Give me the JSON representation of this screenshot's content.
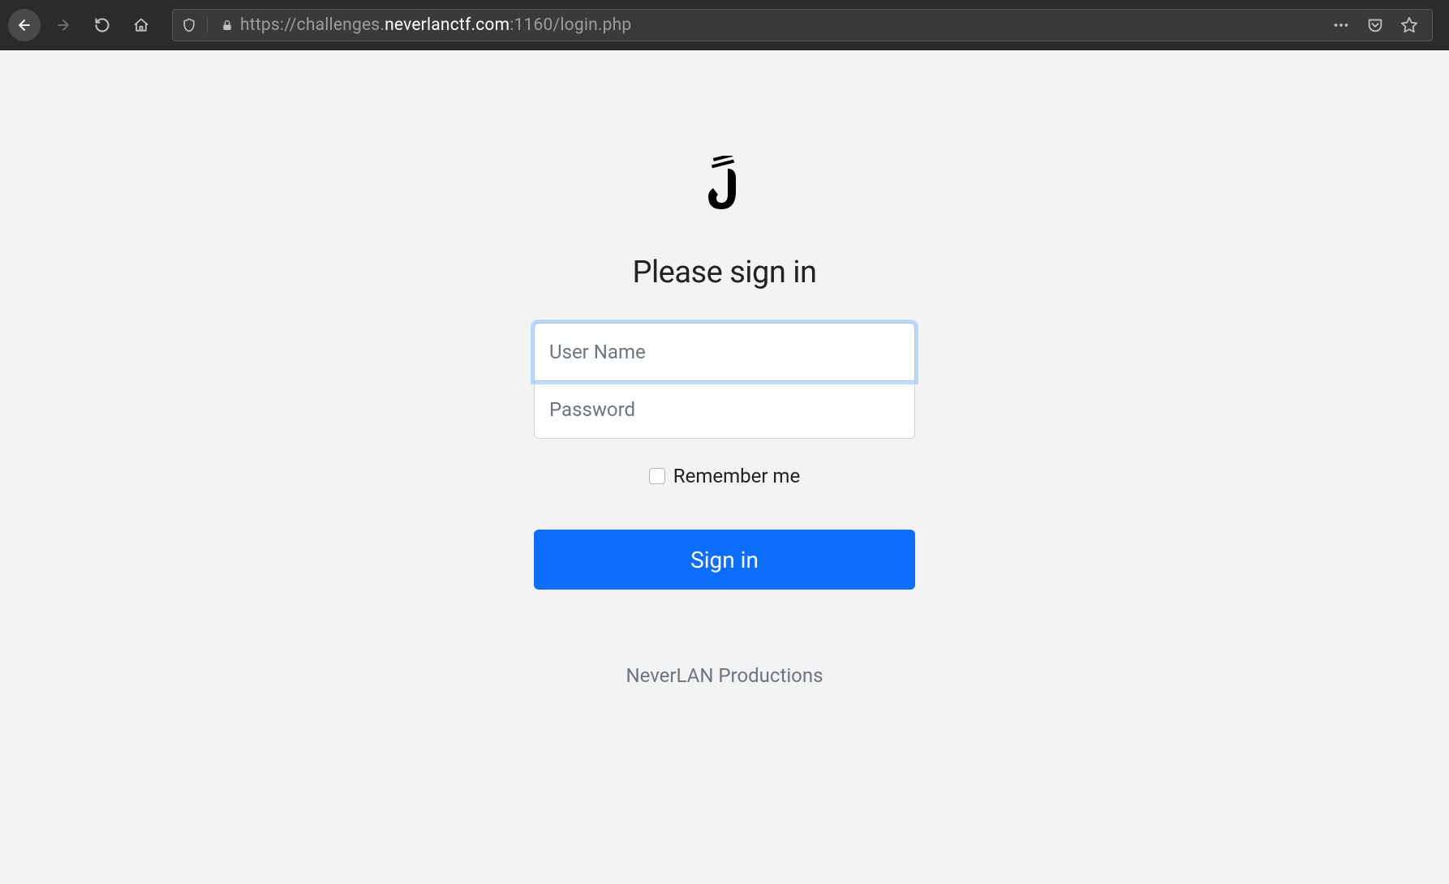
{
  "toolbar": {
    "url_protocol": "https://",
    "url_sub": "challenges.",
    "url_domain": "neverlanctf.com",
    "url_port_path": ":1160/login.php"
  },
  "login": {
    "heading": "Please sign in",
    "username_placeholder": "User Name",
    "username_value": "",
    "password_placeholder": "Password",
    "password_value": "",
    "remember_label": "Remember me",
    "signin_label": "Sign in",
    "footer": "NeverLAN Productions"
  }
}
